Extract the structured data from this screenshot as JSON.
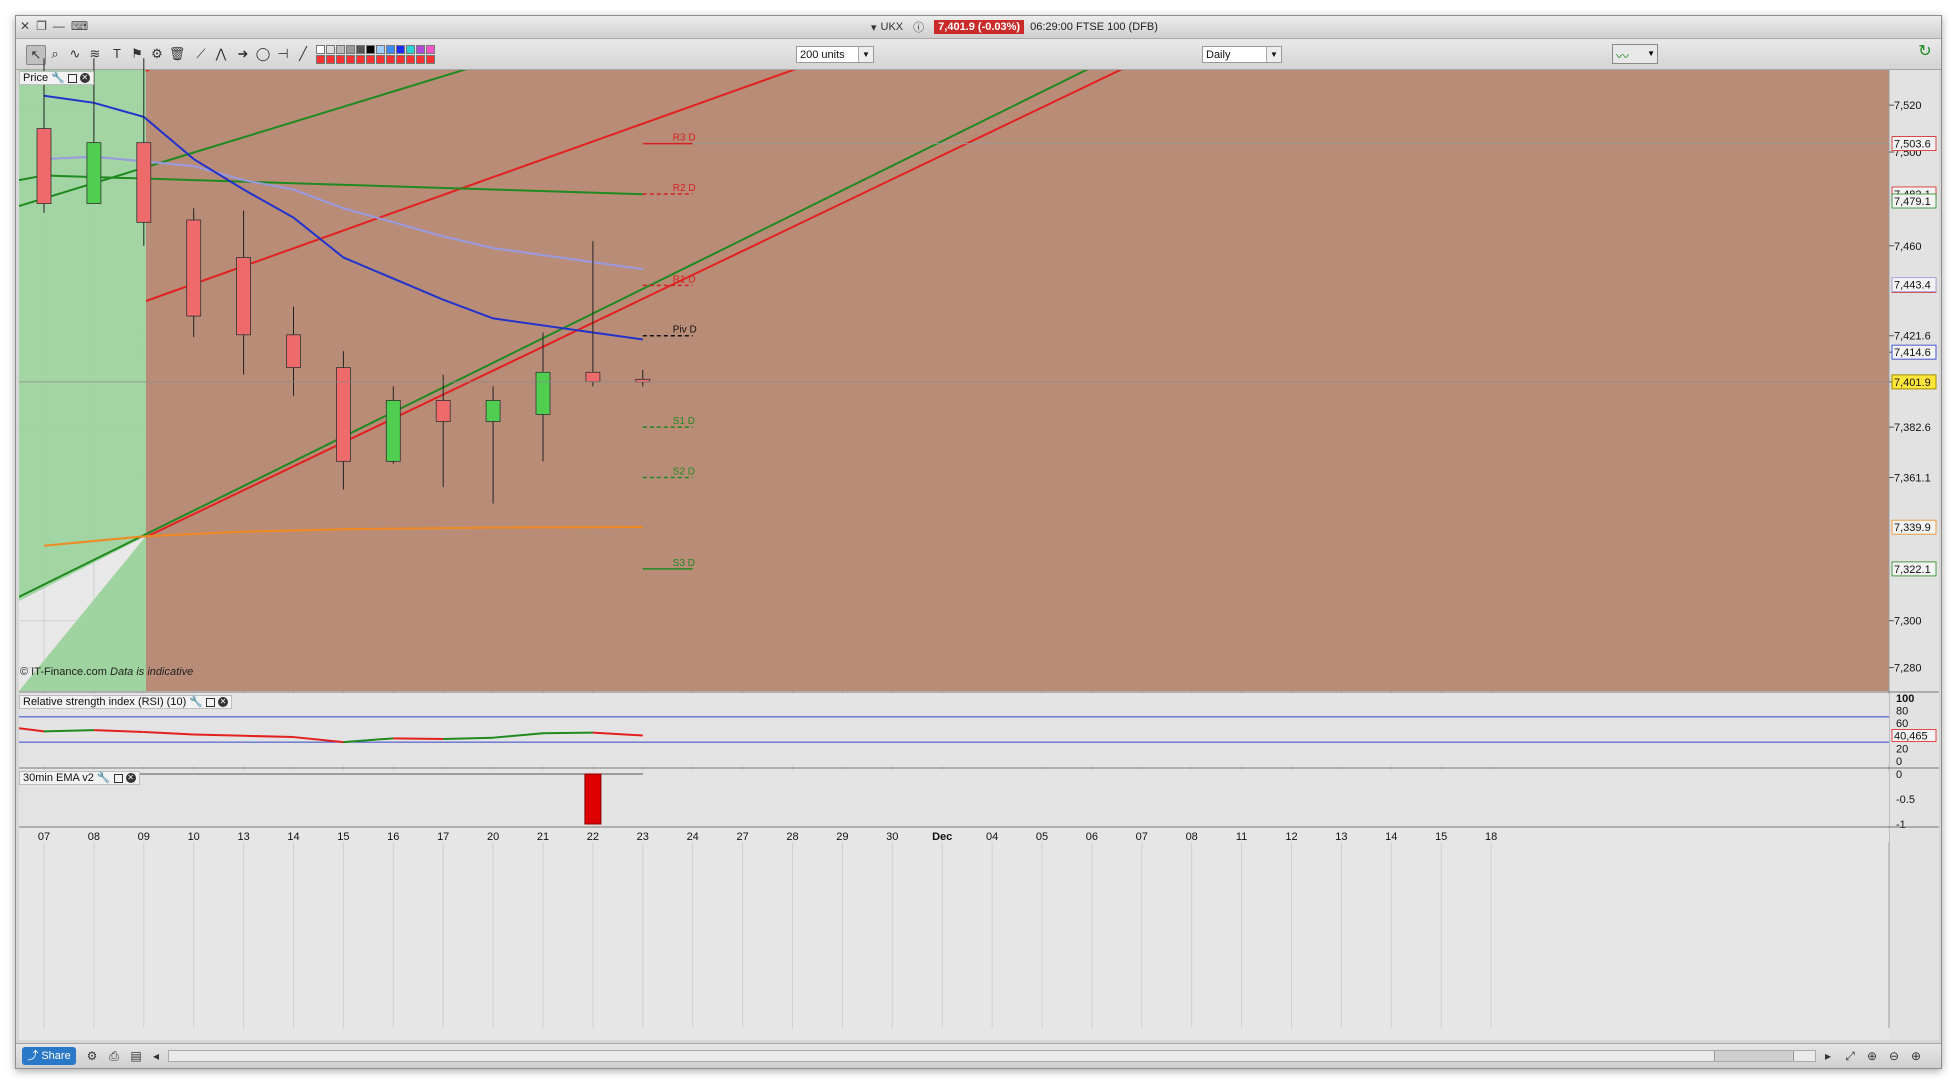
{
  "titlebar": {
    "symbol": "UKX",
    "price_badge": "7,401.9 (-0.03%)",
    "time_desc": "06:29:00 FTSE 100 (DFB)"
  },
  "toolbar": {
    "units_select": "200 units",
    "interval_select": "Daily"
  },
  "price_panel": {
    "label": "Price",
    "copyright": "© IT-Finance.com",
    "disclaimer": "Data is indicative"
  },
  "rsi_panel": {
    "label": "Relative strength index (RSI) (10)"
  },
  "ema_panel": {
    "label": "30min EMA v2"
  },
  "bottombar": {
    "share_label": "Share"
  },
  "colors": {
    "bull": "#4fce4f",
    "bear": "#ef6b6b",
    "ma_fast": "#2233cc",
    "ma_slow": "#9a9ae0",
    "ma_long": "#f08a20",
    "channel_red": "#e32020",
    "channel_green": "#1f8a1f"
  },
  "chart_data": {
    "type": "candlestick",
    "x_labels": [
      "07",
      "08",
      "09",
      "10",
      "13",
      "14",
      "15",
      "16",
      "17",
      "20",
      "21",
      "22",
      "23",
      "24",
      "27",
      "28",
      "29",
      "30",
      "Dec",
      "04",
      "05",
      "06",
      "07",
      "08",
      "11",
      "12",
      "13",
      "14",
      "15",
      "18"
    ],
    "y_ticks": [
      7520,
      7500,
      7460,
      7421.6,
      7414.6,
      7401.9,
      7382.6,
      7361.1,
      7300,
      7280
    ],
    "y_tick_labels": [
      "7,520",
      "7,500",
      "7,460",
      "7,421.6",
      "7,414.6",
      "7,401.9",
      "7,382.6",
      "7,361.1",
      "7,300",
      "7,280"
    ],
    "ylim": [
      7270,
      7535
    ],
    "candles": [
      {
        "x": "07",
        "o": 7510,
        "h": 7540,
        "l": 7474,
        "c": 7478
      },
      {
        "x": "08",
        "o": 7478,
        "h": 7540,
        "l": 7478,
        "c": 7504
      },
      {
        "x": "09",
        "o": 7504,
        "h": 7540,
        "l": 7460,
        "c": 7470
      },
      {
        "x": "10",
        "o": 7471,
        "h": 7476,
        "l": 7421,
        "c": 7430
      },
      {
        "x": "13",
        "o": 7455,
        "h": 7475,
        "l": 7405,
        "c": 7422
      },
      {
        "x": "14",
        "o": 7422,
        "h": 7434,
        "l": 7396,
        "c": 7408
      },
      {
        "x": "15",
        "o": 7408,
        "h": 7415,
        "l": 7356,
        "c": 7368
      },
      {
        "x": "16",
        "o": 7368,
        "h": 7400,
        "l": 7367,
        "c": 7394
      },
      {
        "x": "17",
        "o": 7394,
        "h": 7405,
        "l": 7357,
        "c": 7385
      },
      {
        "x": "20",
        "o": 7385,
        "h": 7400,
        "l": 7350,
        "c": 7394
      },
      {
        "x": "21",
        "o": 7388,
        "h": 7423,
        "l": 7368,
        "c": 7406
      },
      {
        "x": "22",
        "o": 7406,
        "h": 7462,
        "l": 7400,
        "c": 7402
      },
      {
        "x": "23",
        "o": 7403,
        "h": 7407,
        "l": 7400,
        "c": 7401.9
      }
    ],
    "pivots": [
      {
        "name": "R3 D",
        "value": 7503.6,
        "label": "7,503.6",
        "color": "#d42020",
        "style": "solid"
      },
      {
        "name": "R2 D",
        "value": 7482.1,
        "label": "7,482.1",
        "color": "#d42020",
        "style": "dashed"
      },
      {
        "name": "R1 D",
        "value": 7443.1,
        "label": "7,443.1",
        "color": "#d42020",
        "style": "dashed"
      },
      {
        "name": "Piv D",
        "value": 7421.6,
        "label": "7,421.6",
        "color": "#111111",
        "style": "dashed"
      },
      {
        "name": "S1 D",
        "value": 7382.6,
        "label": "7,382.6",
        "color": "#1f8a1f",
        "style": "dashed"
      },
      {
        "name": "S2 D",
        "value": 7361.1,
        "label": "7,361.1",
        "color": "#1f8a1f",
        "style": "dashed"
      },
      {
        "name": "S3 D",
        "value": 7322.1,
        "label": "7,322.1",
        "color": "#1f8a1f",
        "style": "solid"
      }
    ],
    "side_labels": [
      {
        "value": 7479.1,
        "label": "7,479.1",
        "color": "#1f8a1f"
      },
      {
        "value": 7443.4,
        "label": "7,443.4",
        "color": "#9a9ae0"
      },
      {
        "value": 7414.6,
        "label": "7,414.6",
        "color": "#2233cc"
      },
      {
        "value": 7339.9,
        "label": "7,339.9",
        "color": "#f08a20"
      }
    ],
    "ma_fast": [
      7524,
      7521,
      7515,
      7497,
      7484,
      7472,
      7455,
      7446,
      7437,
      7429,
      7426,
      7423,
      7420
    ],
    "ma_slow": [
      7497,
      7498,
      7496,
      7494,
      7488,
      7484,
      7476,
      7470,
      7464,
      7459,
      7456,
      7453,
      7450
    ],
    "ma_long": [
      7332,
      7334,
      7336,
      7337,
      7338,
      7338.5,
      7339,
      7339.3,
      7339.5,
      7339.7,
      7339.8,
      7339.9,
      7340
    ],
    "rsi": {
      "ylim": [
        0,
        100
      ],
      "tick_labels": [
        "100",
        "80",
        "60",
        "40",
        "20",
        "0"
      ],
      "levels": [
        70,
        30
      ],
      "values": [
        52,
        47,
        49,
        46,
        42,
        40,
        38,
        30,
        36,
        35,
        37,
        44,
        45,
        40.465
      ],
      "last_label": "40,465"
    },
    "ema": {
      "tick_labels": [
        "0",
        "-0.5",
        "-1"
      ],
      "bars": [
        {
          "x": "22",
          "value": -1
        }
      ]
    }
  }
}
